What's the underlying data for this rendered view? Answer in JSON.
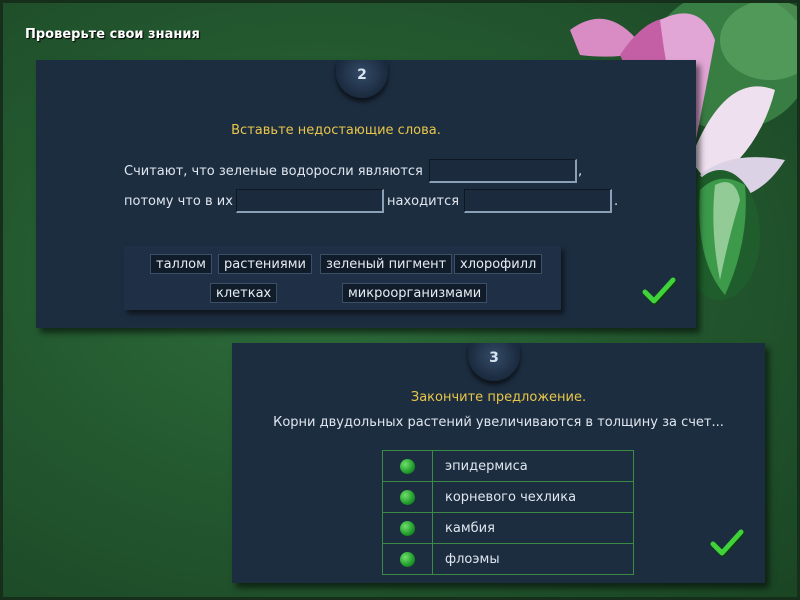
{
  "page": {
    "title": "Проверьте свои знания"
  },
  "task2": {
    "number": "2",
    "instruction": "Вставьте недостающие слова.",
    "line1_text": "Считают, что зеленые водоросли являются",
    "line1_end": ",",
    "line2_start": "потому что в их",
    "line2_middle": "находится",
    "line2_end": ".",
    "word_bank": [
      "таллом",
      "растениями",
      "зеленый пигмент",
      "хлорофилл",
      "клетках",
      "микроорганизмами"
    ]
  },
  "task3": {
    "number": "3",
    "instruction": "Закончите предложение.",
    "question": "Корни двудольных растений увеличиваются в толщину за счет...",
    "options": [
      "эпидермиса",
      "корневого чехлика",
      "камбия",
      "флоэмы"
    ]
  },
  "colors": {
    "accent_yellow": "#e8c64a",
    "check_green": "#3fd23a",
    "panel_bg": "#1d2d40"
  },
  "icons": {
    "check": "checkmark-icon",
    "radio": "radio-dot-icon"
  }
}
